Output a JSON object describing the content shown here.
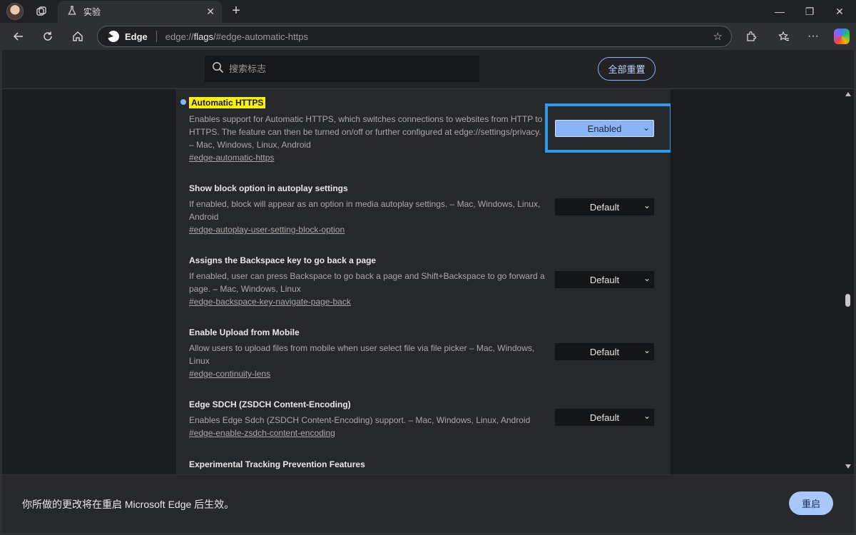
{
  "tab": {
    "title": "实验",
    "close_symbol": "✕"
  },
  "window_controls": {
    "minimize": "—",
    "maximize": "❐",
    "close": "✕"
  },
  "address_bar": {
    "site_label": "Edge",
    "url_prefix": "edge://",
    "url_bold": "flags",
    "url_suffix": "/#edge-automatic-https"
  },
  "header": {
    "search_placeholder": "搜索标志",
    "reset_label": "全部重置"
  },
  "flags": [
    {
      "name": "Automatic HTTPS",
      "description": "Enables support for Automatic HTTPS, which switches connections to websites from HTTP to HTTPS. The feature can then be turned on/off or further configured at edge://settings/privacy. – Mac, Windows, Linux, Android",
      "permalink": "#edge-automatic-https",
      "value": "Enabled"
    },
    {
      "name": "Show block option in autoplay settings",
      "description": "If enabled, block will appear as an option in media autoplay settings. – Mac, Windows, Linux, Android",
      "permalink": "#edge-autoplay-user-setting-block-option",
      "value": "Default"
    },
    {
      "name": "Assigns the Backspace key to go back a page",
      "description": "If enabled, user can press Backspace to go back a page and Shift+Backspace to go forward a page. – Mac, Windows, Linux",
      "permalink": "#edge-backspace-key-navigate-page-back",
      "value": "Default"
    },
    {
      "name": "Enable Upload from Mobile",
      "description": "Allow users to upload files from mobile when user select file via file picker – Mac, Windows, Linux",
      "permalink": "#edge-continuity-lens",
      "value": "Default"
    },
    {
      "name": "Edge SDCH (ZSDCH Content-Encoding)",
      "description": "Enables Edge Sdch (ZSDCH Content-Encoding) support. – Mac, Windows, Linux, Android",
      "permalink": "#edge-enable-zsdch-content-encoding",
      "value": "Default"
    },
    {
      "name": "Experimental Tracking Prevention Features",
      "description": "",
      "permalink": "",
      "value": ""
    }
  ],
  "restart_bar": {
    "message": "你所做的更改将在重启 Microsoft Edge 后生效。",
    "button_label": "重启"
  },
  "colors": {
    "accent": "#8ab4f8",
    "highlight": "#f6ef13",
    "focus_ring": "#2f9ce9"
  }
}
